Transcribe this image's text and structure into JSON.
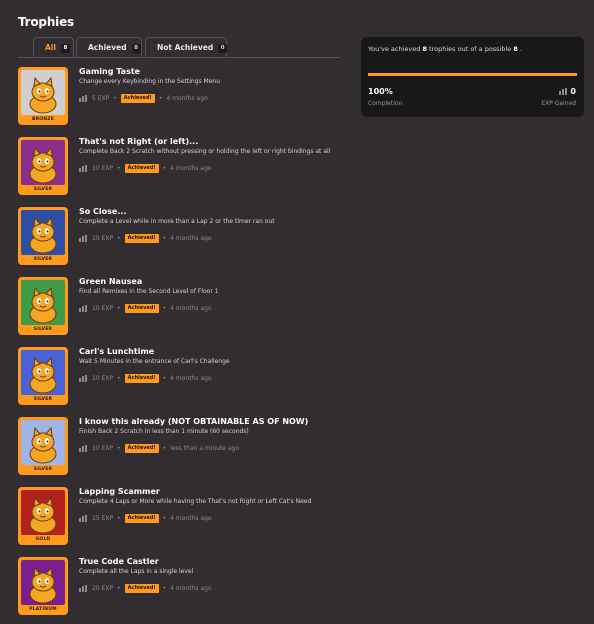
{
  "page": {
    "title": "Trophies"
  },
  "tabs": [
    {
      "label": "All",
      "count": "8",
      "active": true
    },
    {
      "label": "Achieved",
      "count": "8",
      "active": false
    },
    {
      "label": "Not Achieved",
      "count": "0",
      "active": false
    }
  ],
  "summary": {
    "prefix": "You've achieved",
    "achieved": "8",
    "middle": "trophies out of a possible",
    "total": "8",
    "suffix": ".",
    "completion_value": "100%",
    "completion_fraction": 1.0,
    "completion_label": "Completion",
    "exp_value": "0",
    "exp_label": "EXP Gained"
  },
  "colors": {
    "accent": "#ff9a1c",
    "background": "#312d30",
    "panel": "#18171a"
  },
  "trophies": [
    {
      "name": "Gaming Taste",
      "description": "Change every Keybinding in the Settings Menu",
      "exp": "5 EXP",
      "status": "Achieved!",
      "time": "4 months ago",
      "tier": "BRONZE",
      "icon": "scratch-cat-gamer-icon",
      "bg": "#cfcfd2"
    },
    {
      "name": "That's not Right (or left)...",
      "description": "Complete Back 2 Scratch without pressing or holding the left or right bindings at all",
      "exp": "10 EXP",
      "status": "Achieved!",
      "time": "4 months ago",
      "tier": "SILVER",
      "icon": "no-arrows-icon",
      "bg": "#8b2f8f"
    },
    {
      "name": "So Close...",
      "description": "Complete a Level while in more than a Lap 2 or the timer ran out",
      "exp": "10 EXP",
      "status": "Achieved!",
      "time": "4 months ago",
      "tier": "SILVER",
      "icon": "clock-cat-icon",
      "bg": "#2e4fa8"
    },
    {
      "name": "Green Nausea",
      "description": "Find all Remixes in the Second Level of Floor 1",
      "exp": "10 EXP",
      "status": "Achieved!",
      "time": "4 months ago",
      "tier": "SILVER",
      "icon": "sick-cat-icon",
      "bg": "#3f9a4a"
    },
    {
      "name": "Carl's Lunchtime",
      "description": "Wait 5 Minutes in the entrance of Carl's Challenge",
      "exp": "10 EXP",
      "status": "Achieved!",
      "time": "4 months ago",
      "tier": "SILVER",
      "icon": "carl-icon",
      "bg": "#4a62d8"
    },
    {
      "name": "I know this already (NOT OBTAINABLE AS OF NOW)",
      "description": "Finish Back 2 Scratch in less than 1 minute (60 seconds)",
      "exp": "10 EXP",
      "status": "Achieved!",
      "time": "less than a minute ago",
      "tier": "SILVER",
      "icon": "twin-cats-icon",
      "bg": "#9fb4e8"
    },
    {
      "name": "Lapping Scammer",
      "description": "Complete 4 Laps or More while having the That's not Right or Left Cat's Need",
      "exp": "15 EXP",
      "status": "Achieved!",
      "time": "4 months ago",
      "tier": "GOLD",
      "icon": "scammer-cat-icon",
      "bg": "#b3211c"
    },
    {
      "name": "True Code Castler",
      "description": "Complete all the Laps in a single level",
      "exp": "20 EXP",
      "status": "Achieved!",
      "time": "4 months ago",
      "tier": "PLATINUM",
      "icon": "crowned-cat-icon",
      "bg": "#7a1f8f"
    }
  ]
}
